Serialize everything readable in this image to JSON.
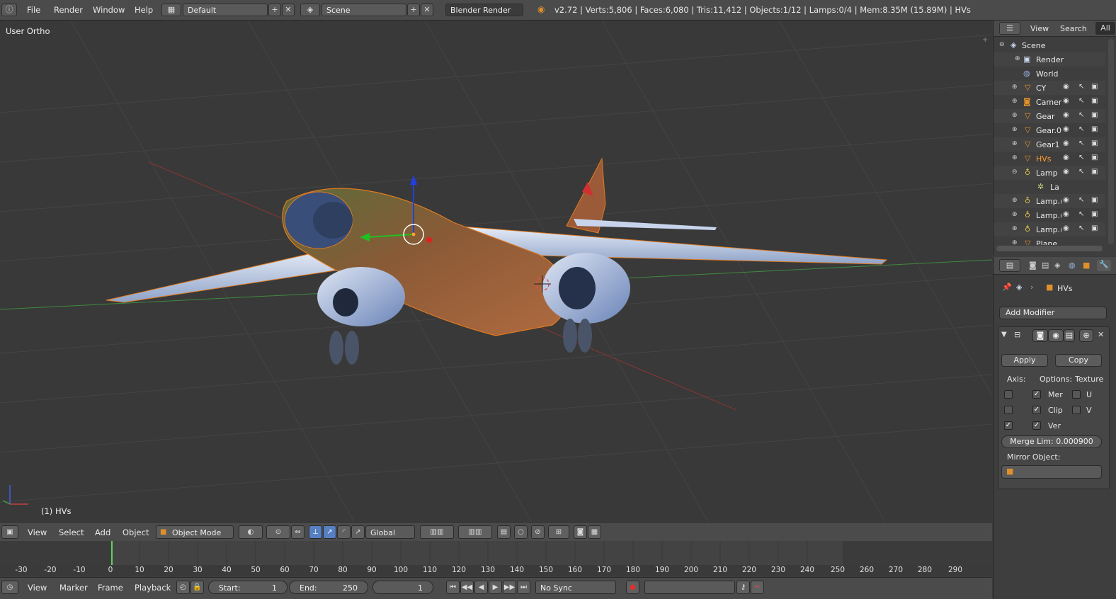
{
  "top_menu": {
    "items": [
      "File",
      "Render",
      "Window",
      "Help"
    ],
    "screen_layout": "Default",
    "scene": "Scene",
    "render_engine": "Blender Render",
    "stats": "v2.72 | Verts:5,806 | Faces:6,080 | Tris:11,412 | Objects:1/12 | Lamps:0/4 | Mem:8.35M (15.89M) | HVs"
  },
  "viewport": {
    "view_label": "User Ortho",
    "object_label": "(1) HVs"
  },
  "view3d_header": {
    "menus": [
      "View",
      "Select",
      "Add",
      "Object"
    ],
    "mode": "Object Mode",
    "orientation": "Global"
  },
  "timeline": {
    "ticks": [
      "-30",
      "-20",
      "-10",
      "0",
      "10",
      "20",
      "30",
      "40",
      "50",
      "60",
      "70",
      "80",
      "90",
      "100",
      "110",
      "120",
      "130",
      "140",
      "150",
      "160",
      "170",
      "180",
      "190",
      "200",
      "210",
      "220",
      "230",
      "240",
      "250",
      "260",
      "270",
      "280",
      "290"
    ],
    "menus": [
      "View",
      "Marker",
      "Frame",
      "Playback"
    ],
    "start_label": "Start:",
    "start_value": "1",
    "end_label": "End:",
    "end_value": "250",
    "current_frame": "1",
    "sync": "No Sync"
  },
  "outliner": {
    "header": {
      "view": "View",
      "search": "Search",
      "filter": "All"
    },
    "rows": [
      {
        "name": "Scene",
        "indent": 0,
        "icon": "scene-icon",
        "vis": false
      },
      {
        "name": "Render",
        "indent": 1,
        "icon": "render-icon",
        "vis": false
      },
      {
        "name": "World",
        "indent": 1,
        "icon": "world-icon",
        "vis": false
      },
      {
        "name": "CY",
        "indent": 1,
        "icon": "mesh-icon",
        "vis": true
      },
      {
        "name": "Camer",
        "indent": 1,
        "icon": "camera-icon",
        "vis": true
      },
      {
        "name": "Gear",
        "indent": 1,
        "icon": "mesh-icon",
        "vis": true
      },
      {
        "name": "Gear.0",
        "indent": 1,
        "icon": "mesh-icon",
        "vis": true
      },
      {
        "name": "Gear1",
        "indent": 1,
        "icon": "mesh-icon",
        "vis": true
      },
      {
        "name": "HVs",
        "indent": 1,
        "icon": "mesh-icon",
        "vis": true,
        "selected": true
      },
      {
        "name": "Lamp",
        "indent": 1,
        "icon": "lamp-icon",
        "vis": true
      },
      {
        "name": "La",
        "indent": 2,
        "icon": "lamp-data-icon",
        "vis": false
      },
      {
        "name": "Lamp.(",
        "indent": 1,
        "icon": "lamp-icon",
        "vis": true
      },
      {
        "name": "Lamp.(",
        "indent": 1,
        "icon": "lamp-icon",
        "vis": true
      },
      {
        "name": "Lamp.(",
        "indent": 1,
        "icon": "lamp-icon",
        "vis": true
      },
      {
        "name": "Plane",
        "indent": 1,
        "icon": "mesh-icon",
        "vis": true
      }
    ]
  },
  "properties": {
    "object_name": "HVs",
    "add_modifier": "Add Modifier",
    "apply": "Apply",
    "copy": "Copy",
    "axis_label": "Axis:",
    "options_label": "Options:",
    "texture_label": "Texture",
    "options": [
      "Mer",
      "Clip",
      "Ver"
    ],
    "texture": [
      "U",
      "V"
    ],
    "merge_limit": "Merge Lim: 0.000900",
    "mirror_object_label": "Mirror Object:"
  },
  "colors": {
    "accent": "#5680c2",
    "selected_text": "#ff9c2e",
    "x_axis": "#c04040",
    "y_axis": "#40a040"
  }
}
